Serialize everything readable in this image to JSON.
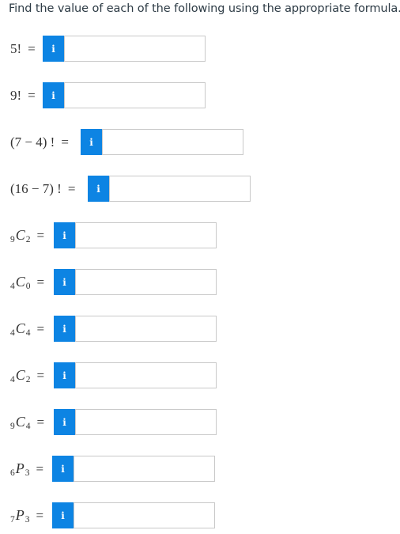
{
  "instructions": "Find the value of each of the following using the appropriate formula.",
  "info_icon_glyph": "i",
  "accent_color": "#0d84e3",
  "questions": [
    {
      "base": "5!",
      "equals": "="
    },
    {
      "base": "9!",
      "equals": "="
    },
    {
      "base": "(7 − 4) !",
      "equals": "="
    },
    {
      "base": "(16 − 7) !",
      "equals": "="
    },
    {
      "pre": "9",
      "var": "C",
      "sub": "2",
      "equals": "="
    },
    {
      "pre": "4",
      "var": "C",
      "sub": "0",
      "equals": "="
    },
    {
      "pre": "4",
      "var": "C",
      "sub": "4",
      "equals": "="
    },
    {
      "pre": "4",
      "var": "C",
      "sub": "2",
      "equals": "="
    },
    {
      "pre": "9",
      "var": "C",
      "sub": "4",
      "equals": "="
    },
    {
      "pre": "6",
      "var": "P",
      "sub": "3",
      "equals": "="
    },
    {
      "pre": "7",
      "var": "P",
      "sub": "3",
      "equals": "="
    }
  ],
  "answers": [
    "",
    "",
    "",
    "",
    "",
    "",
    "",
    "",
    "",
    "",
    ""
  ]
}
